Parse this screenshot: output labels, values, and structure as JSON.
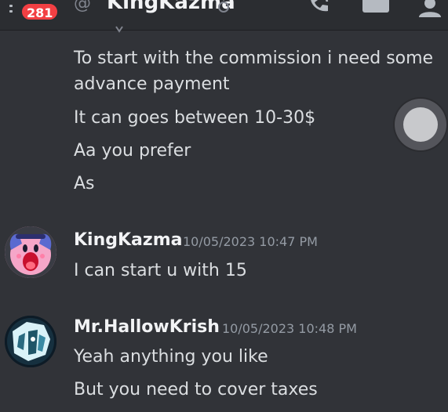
{
  "header": {
    "unread_count": "281",
    "at_symbol": "@",
    "channel_name": "KingKazma"
  },
  "messages": [
    {
      "lines": [
        "To start with the commission i need some",
        "advance payment",
        "It can goes between 10-30$",
        "Aa you prefer",
        "As"
      ]
    },
    {
      "author": "KingKazma",
      "timestamp": "10/05/2023 10:47 PM",
      "lines": [
        "I can start u with 15"
      ]
    },
    {
      "author": "Mr.HallowKrish",
      "timestamp": "10/05/2023 10:48 PM",
      "lines": [
        "Yeah anything you like",
        "But you need to cover taxes"
      ]
    }
  ],
  "colors": {
    "background": "#313338",
    "badge": "#f23f43",
    "text": "#dbdee1"
  }
}
